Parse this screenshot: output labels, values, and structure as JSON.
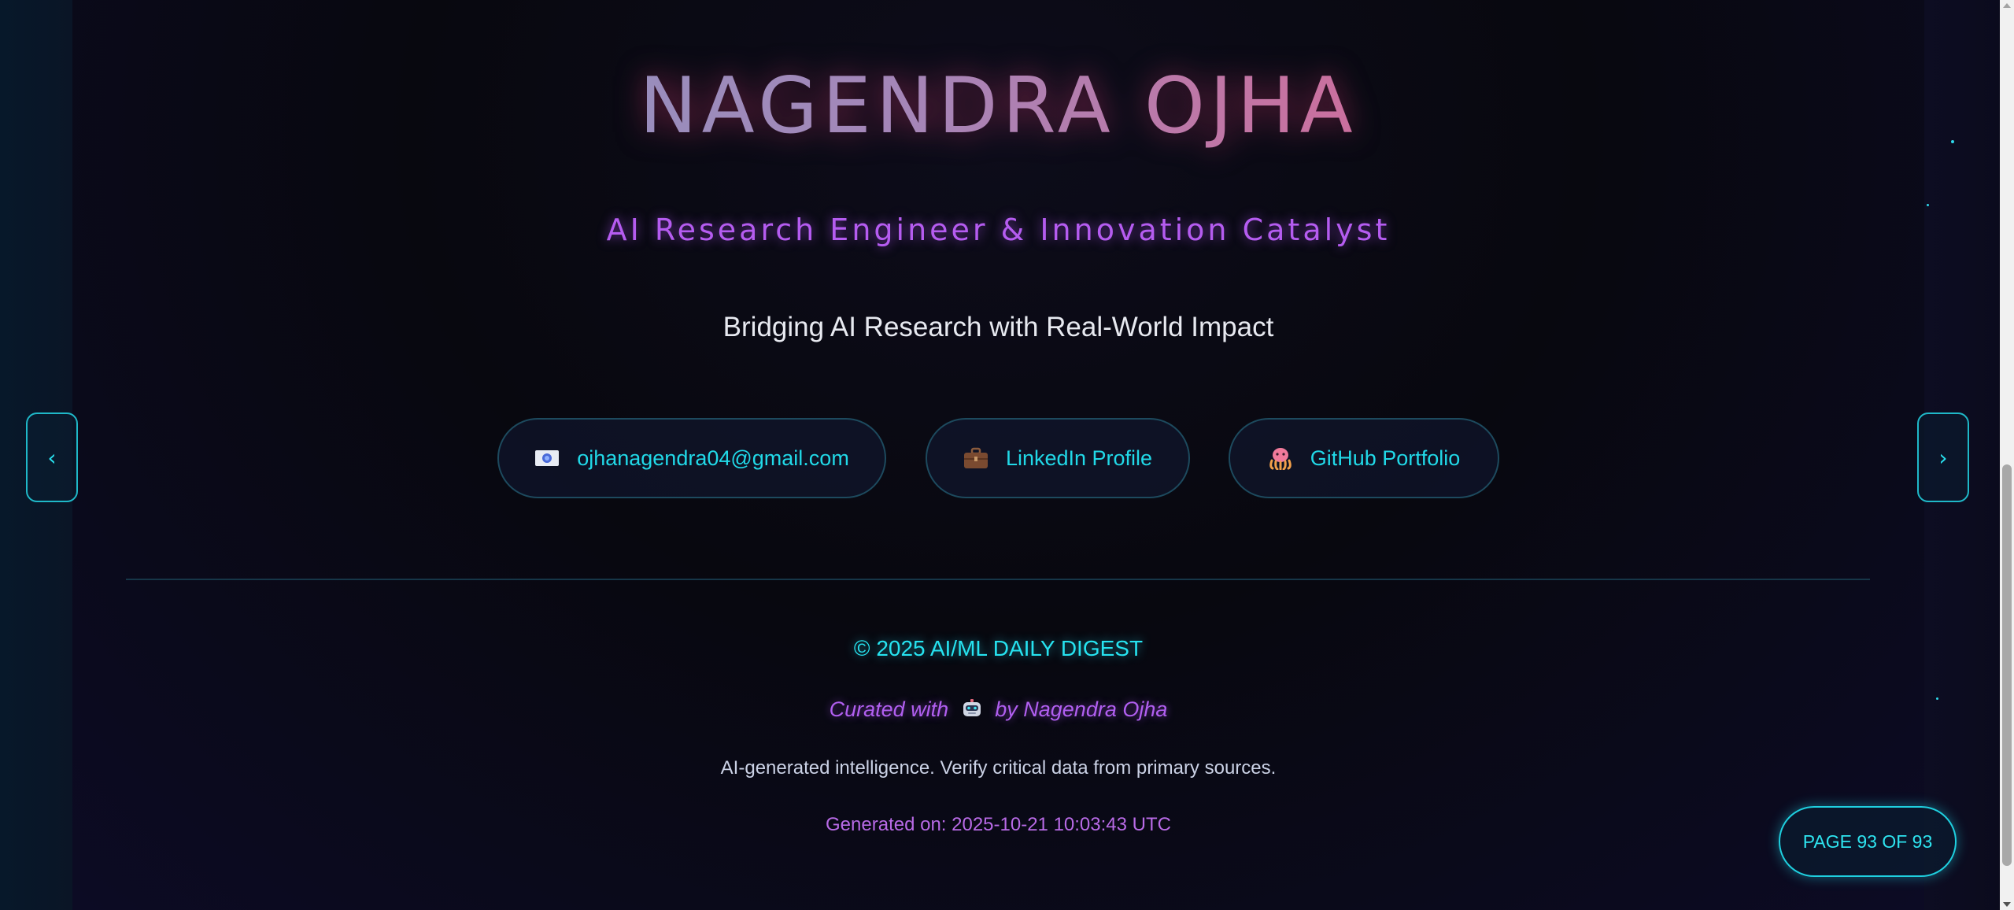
{
  "header": {
    "name": "NAGENDRA OJHA",
    "subtitle": "AI Research Engineer & Innovation Catalyst",
    "tagline": "Bridging AI Research with Real-World Impact"
  },
  "contacts": [
    {
      "label": "ojhanagendra04@gmail.com",
      "icon": "email-icon"
    },
    {
      "label": "LinkedIn Profile",
      "icon": "briefcase-icon"
    },
    {
      "label": "GitHub Portfolio",
      "icon": "octopus-icon"
    }
  ],
  "navigation": {
    "prev_label": "‹",
    "next_label": "›"
  },
  "footer": {
    "copyright": "© 2025 AI/ML DAILY DIGEST",
    "curated_prefix": "Curated with",
    "curated_suffix": "by Nagendra Ojha",
    "disclaimer": "AI-generated intelligence. Verify critical data from primary sources.",
    "generated": "Generated on: 2025-10-21 10:03:43 UTC"
  },
  "pagination": {
    "label": "PAGE 93 OF 93"
  },
  "colors": {
    "accent_cyan": "#21d9e8",
    "accent_purple": "#b55cf0",
    "accent_pink": "#e05a88",
    "background": "#08080f"
  }
}
